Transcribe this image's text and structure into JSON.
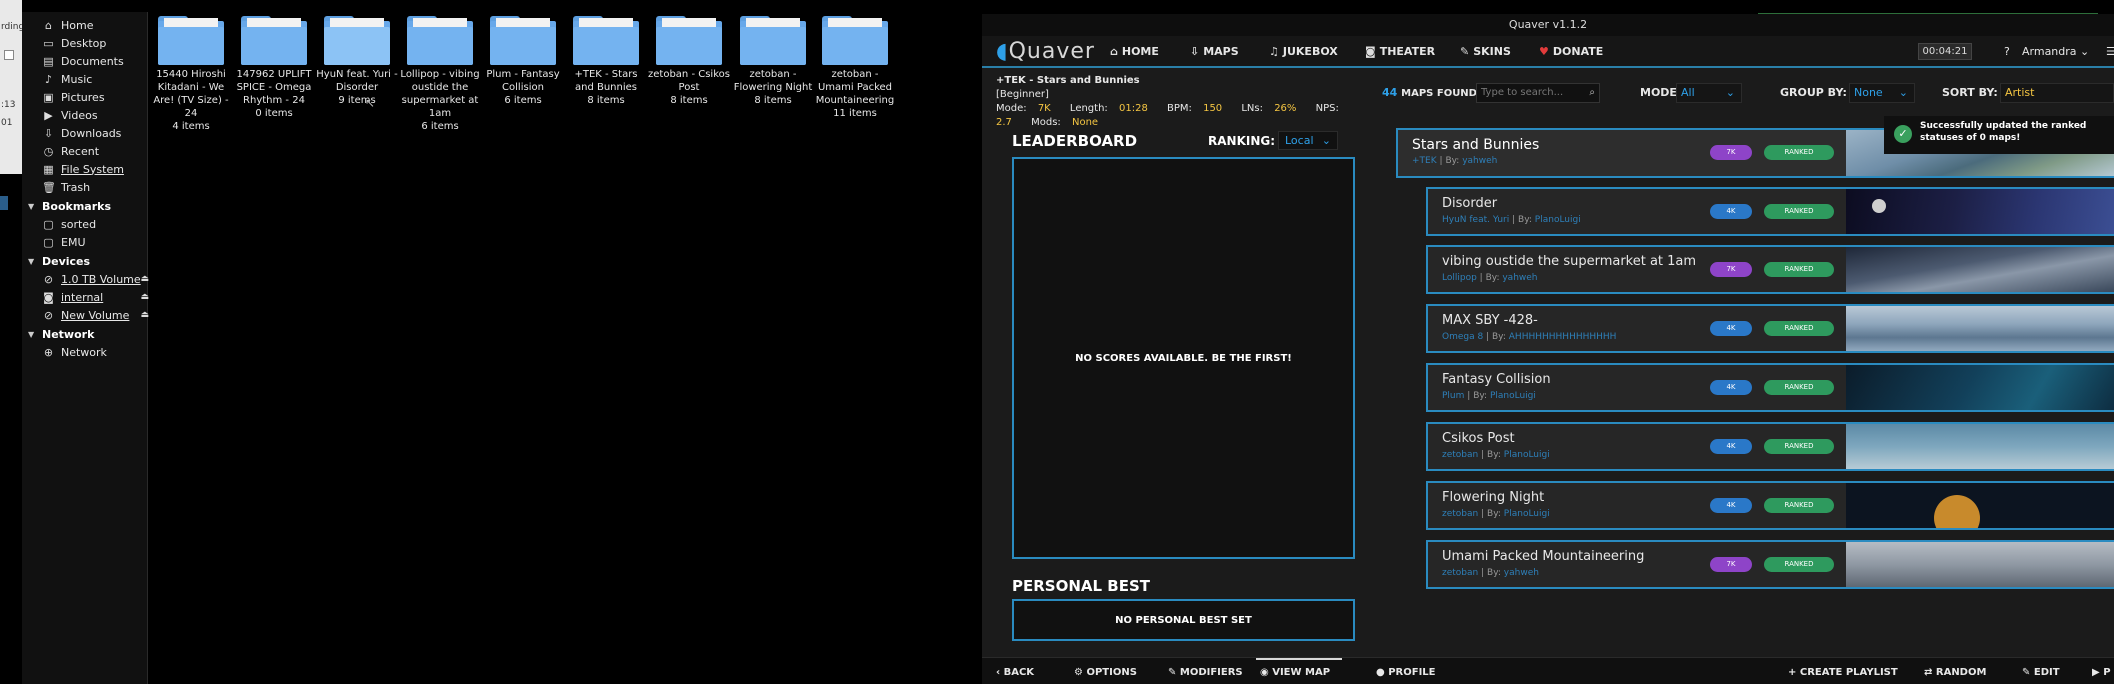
{
  "file_manager": {
    "left_edge_texts": [
      "rding",
      ":13",
      "01"
    ],
    "sidebar": {
      "places": [
        {
          "label": "Home",
          "icon": "home-icon"
        },
        {
          "label": "Desktop",
          "icon": "desktop-icon"
        },
        {
          "label": "Documents",
          "icon": "documents-icon"
        },
        {
          "label": "Music",
          "icon": "music-icon"
        },
        {
          "label": "Pictures",
          "icon": "pictures-icon"
        },
        {
          "label": "Videos",
          "icon": "videos-icon"
        },
        {
          "label": "Downloads",
          "icon": "downloads-icon"
        },
        {
          "label": "Recent",
          "icon": "recent-icon"
        },
        {
          "label": "File System",
          "icon": "file-system-icon"
        },
        {
          "label": "Trash",
          "icon": "trash-icon"
        }
      ],
      "bookmarks_header": "Bookmarks",
      "bookmarks": [
        {
          "label": "sorted"
        },
        {
          "label": "EMU"
        }
      ],
      "devices_header": "Devices",
      "devices": [
        {
          "label": "1.0 TB Volume"
        },
        {
          "label": "internal"
        },
        {
          "label": "New Volume"
        }
      ],
      "network_header": "Network",
      "network": [
        {
          "label": "Network"
        }
      ]
    },
    "folders": [
      {
        "name": "15440 Hiroshi Kitadani - We Are! (TV Size) - 24",
        "count": "4 items"
      },
      {
        "name": "147962 UPLIFT SPICE - Omega Rhythm - 24",
        "count": "0 items"
      },
      {
        "name": "HyuN feat. Yuri - Disorder",
        "count": "9 items"
      },
      {
        "name": "Lollipop - vibing oustide the supermarket at 1am",
        "count": "6 items"
      },
      {
        "name": "Plum - Fantasy Collision",
        "count": "6 items"
      },
      {
        "name": "+TEK - Stars and Bunnies",
        "count": "8 items"
      },
      {
        "name": "zetoban - Csikos Post",
        "count": "8 items"
      },
      {
        "name": "zetoban - Flowering Night",
        "count": "8 items"
      },
      {
        "name": "zetoban - Umami Packed Mountaineering",
        "count": "11 items"
      }
    ]
  },
  "quaver": {
    "window_title": "Quaver v1.1.2",
    "logo": "Quaver",
    "nav": {
      "home": "HOME",
      "maps": "MAPS",
      "jukebox": "JUKEBOX",
      "theater": "THEATER",
      "skins": "SKINS",
      "donate": "DONATE",
      "timer": "00:04:21",
      "help": "?",
      "user": "Armandra"
    },
    "map_info": {
      "title": "+TEK - Stars and Bunnies",
      "difficulty": "[Beginner]",
      "mode_label": "Mode:",
      "mode_value": "7K",
      "length_label": "Length:",
      "length_value": "01:28",
      "bpm_label": "BPM:",
      "bpm_value": "150",
      "lns_label": "LNs:",
      "lns_value": "26%",
      "nps_label": "NPS:",
      "nps_value": "2.7",
      "mods_label": "Mods:",
      "mods_value": "None"
    },
    "filters": {
      "maps_found_count": "44",
      "maps_found_label": "MAPS FOUND",
      "search_placeholder": "Type to search...",
      "mode_label": "MODE:",
      "mode_value": "All",
      "group_label": "GROUP BY:",
      "group_value": "None",
      "sort_label": "SORT BY:",
      "sort_value": "Artist"
    },
    "leaderboard": {
      "title": "LEADERBOARD",
      "ranking_label": "RANKING:",
      "ranking_value": "Local",
      "empty_text": "NO SCORES AVAILABLE. BE THE FIRST!"
    },
    "personal_best": {
      "title": "PERSONAL BEST",
      "empty_text": "NO PERSONAL BEST SET"
    },
    "toast": "Successfully updated the ranked statuses of 0 maps!",
    "songs": [
      {
        "title": "Stars and Bunnies",
        "artist": "+TEK",
        "by_label": "By:",
        "creator": "yahweh",
        "keys": "7K",
        "status": "RANKED"
      },
      {
        "title": "Disorder",
        "artist": "HyuN feat. Yuri",
        "by_label": "By:",
        "creator": "PlanoLuigi",
        "keys": "4K",
        "status": "RANKED"
      },
      {
        "title": "vibing oustide the supermarket at 1am",
        "artist": "Lollipop",
        "by_label": "By:",
        "creator": "yahweh",
        "keys": "7K",
        "status": "RANKED"
      },
      {
        "title": "MAX SBY -428-",
        "artist": "Omega 8",
        "by_label": "By:",
        "creator": "AHHHHHHHHHHHHHHH",
        "keys": "4K",
        "status": "RANKED"
      },
      {
        "title": "Fantasy Collision",
        "artist": "Plum",
        "by_label": "By:",
        "creator": "PlanoLuigi",
        "keys": "4K",
        "status": "RANKED"
      },
      {
        "title": "Csikos Post",
        "artist": "zetoban",
        "by_label": "By:",
        "creator": "PlanoLuigi",
        "keys": "4K",
        "status": "RANKED"
      },
      {
        "title": "Flowering Night",
        "artist": "zetoban",
        "by_label": "By:",
        "creator": "PlanoLuigi",
        "keys": "4K",
        "status": "RANKED"
      },
      {
        "title": "Umami Packed Mountaineering",
        "artist": "zetoban",
        "by_label": "By:",
        "creator": "yahweh",
        "keys": "7K",
        "status": "RANKED"
      }
    ],
    "bottom": {
      "back": "BACK",
      "options": "OPTIONS",
      "modifiers": "MODIFIERS",
      "view_map": "VIEW MAP",
      "profile": "PROFILE",
      "create_playlist": "CREATE PLAYLIST",
      "random": "RANDOM",
      "edit": "EDIT",
      "play": "P"
    }
  }
}
